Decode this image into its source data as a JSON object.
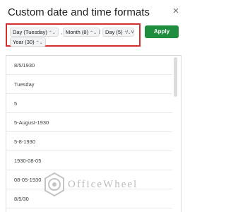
{
  "dialog": {
    "title": "Custom date and time formats",
    "close_glyph": "×"
  },
  "format_bar": {
    "chips": [
      {
        "label": "Day (Tuesday)",
        "arrows": "⌃⌄"
      },
      {
        "label": "Month (8)",
        "arrows": "⌃⌄"
      },
      {
        "label": "Day (5)",
        "arrows": "⌃⌄"
      },
      {
        "label": "Year (30)",
        "arrows": "⌃⌄"
      }
    ],
    "separators": [
      ",",
      "/",
      "/"
    ],
    "dropdown_glyph": "∨",
    "border_color": "#d32f2f"
  },
  "apply_button": {
    "label": "Apply",
    "color": "#1e8e3e"
  },
  "format_list": {
    "items": [
      "8/5/1930",
      "Tuesday",
      "5",
      "5-August-1930",
      "5-8-1930",
      "1930-08-05",
      "08-05-1930",
      "8/5/30"
    ]
  },
  "watermark": {
    "text": "OfficeWheel",
    "icon": "officewheel-logo-icon"
  }
}
